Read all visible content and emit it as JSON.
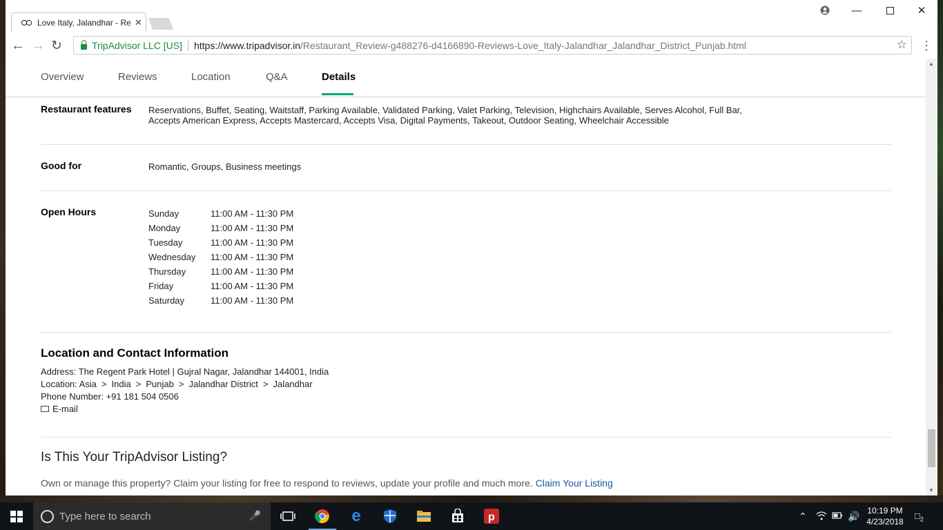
{
  "browser": {
    "tab_title": "Love Italy, Jalandhar - Re",
    "secure_label": "TripAdvisor LLC [US]",
    "url_host": "https://www.tripadvisor.in",
    "url_path": "/Restaurant_Review-g488276-d4166890-Reviews-Love_Italy-Jalandhar_Jalandhar_District_Punjab.html"
  },
  "subnav": {
    "tabs": [
      "Overview",
      "Reviews",
      "Location",
      "Q&A",
      "Details"
    ],
    "active": "Details"
  },
  "details": {
    "features_label": "Restaurant features",
    "features_line1": "Reservations, Buffet, Seating, Waitstaff, Parking Available, Validated Parking, Valet Parking, Television, Highchairs Available, Serves Alcohol, Full Bar,",
    "features_line2": "Accepts American Express, Accepts Mastercard, Accepts Visa, Digital Payments, Takeout, Outdoor Seating, Wheelchair Accessible",
    "good_for_label": "Good for",
    "good_for": "Romantic, Groups, Business meetings",
    "hours_label": "Open Hours",
    "hours": [
      {
        "day": "Sunday",
        "time": "11:00 AM - 11:30 PM"
      },
      {
        "day": "Monday",
        "time": "11:00 AM - 11:30 PM"
      },
      {
        "day": "Tuesday",
        "time": "11:00 AM - 11:30 PM"
      },
      {
        "day": "Wednesday",
        "time": "11:00 AM - 11:30 PM"
      },
      {
        "day": "Thursday",
        "time": "11:00 AM - 11:30 PM"
      },
      {
        "day": "Friday",
        "time": "11:00 AM - 11:30 PM"
      },
      {
        "day": "Saturday",
        "time": "11:00 AM - 11:30 PM"
      }
    ]
  },
  "contact": {
    "heading": "Location and Contact Information",
    "address_label": "Address:",
    "address": "The Regent Park Hotel | Gujral Nagar, Jalandhar 144001, India",
    "location_label": "Location:",
    "location_path": [
      "Asia",
      "India",
      "Punjab",
      "Jalandhar District",
      "Jalandhar"
    ],
    "phone_label": "Phone Number:",
    "phone": "+91 181 504 0506",
    "email_label": "E-mail"
  },
  "listing": {
    "heading": "Is This Your TripAdvisor Listing?",
    "text": "Own or manage this property? Claim your listing for free to respond to reviews, update your profile and much more.",
    "link": "Claim Your Listing"
  },
  "taskbar": {
    "search_placeholder": "Type here to search",
    "time": "10:19 PM",
    "date": "4/23/2018",
    "notifications": "2"
  },
  "colors": {
    "accent": "#00a680",
    "link": "#1a5aa0",
    "secure": "#1e8a3e"
  }
}
